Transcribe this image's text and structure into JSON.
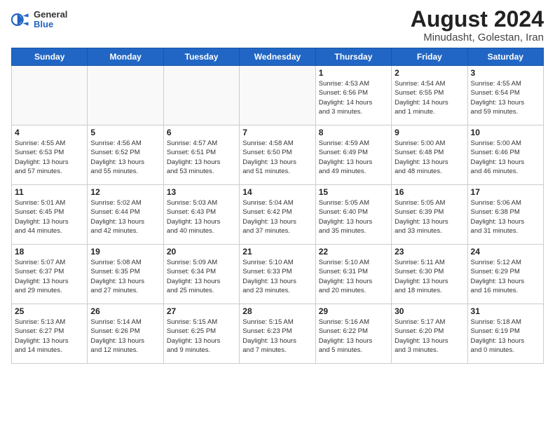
{
  "header": {
    "logo_general": "General",
    "logo_blue": "Blue",
    "title": "August 2024",
    "subtitle": "Minudasht, Golestan, Iran"
  },
  "days_of_week": [
    "Sunday",
    "Monday",
    "Tuesday",
    "Wednesday",
    "Thursday",
    "Friday",
    "Saturday"
  ],
  "weeks": [
    [
      {
        "day": "",
        "info": ""
      },
      {
        "day": "",
        "info": ""
      },
      {
        "day": "",
        "info": ""
      },
      {
        "day": "",
        "info": ""
      },
      {
        "day": "1",
        "info": "Sunrise: 4:53 AM\nSunset: 6:56 PM\nDaylight: 14 hours\nand 3 minutes."
      },
      {
        "day": "2",
        "info": "Sunrise: 4:54 AM\nSunset: 6:55 PM\nDaylight: 14 hours\nand 1 minute."
      },
      {
        "day": "3",
        "info": "Sunrise: 4:55 AM\nSunset: 6:54 PM\nDaylight: 13 hours\nand 59 minutes."
      }
    ],
    [
      {
        "day": "4",
        "info": "Sunrise: 4:55 AM\nSunset: 6:53 PM\nDaylight: 13 hours\nand 57 minutes."
      },
      {
        "day": "5",
        "info": "Sunrise: 4:56 AM\nSunset: 6:52 PM\nDaylight: 13 hours\nand 55 minutes."
      },
      {
        "day": "6",
        "info": "Sunrise: 4:57 AM\nSunset: 6:51 PM\nDaylight: 13 hours\nand 53 minutes."
      },
      {
        "day": "7",
        "info": "Sunrise: 4:58 AM\nSunset: 6:50 PM\nDaylight: 13 hours\nand 51 minutes."
      },
      {
        "day": "8",
        "info": "Sunrise: 4:59 AM\nSunset: 6:49 PM\nDaylight: 13 hours\nand 49 minutes."
      },
      {
        "day": "9",
        "info": "Sunrise: 5:00 AM\nSunset: 6:48 PM\nDaylight: 13 hours\nand 48 minutes."
      },
      {
        "day": "10",
        "info": "Sunrise: 5:00 AM\nSunset: 6:46 PM\nDaylight: 13 hours\nand 46 minutes."
      }
    ],
    [
      {
        "day": "11",
        "info": "Sunrise: 5:01 AM\nSunset: 6:45 PM\nDaylight: 13 hours\nand 44 minutes."
      },
      {
        "day": "12",
        "info": "Sunrise: 5:02 AM\nSunset: 6:44 PM\nDaylight: 13 hours\nand 42 minutes."
      },
      {
        "day": "13",
        "info": "Sunrise: 5:03 AM\nSunset: 6:43 PM\nDaylight: 13 hours\nand 40 minutes."
      },
      {
        "day": "14",
        "info": "Sunrise: 5:04 AM\nSunset: 6:42 PM\nDaylight: 13 hours\nand 37 minutes."
      },
      {
        "day": "15",
        "info": "Sunrise: 5:05 AM\nSunset: 6:40 PM\nDaylight: 13 hours\nand 35 minutes."
      },
      {
        "day": "16",
        "info": "Sunrise: 5:05 AM\nSunset: 6:39 PM\nDaylight: 13 hours\nand 33 minutes."
      },
      {
        "day": "17",
        "info": "Sunrise: 5:06 AM\nSunset: 6:38 PM\nDaylight: 13 hours\nand 31 minutes."
      }
    ],
    [
      {
        "day": "18",
        "info": "Sunrise: 5:07 AM\nSunset: 6:37 PM\nDaylight: 13 hours\nand 29 minutes."
      },
      {
        "day": "19",
        "info": "Sunrise: 5:08 AM\nSunset: 6:35 PM\nDaylight: 13 hours\nand 27 minutes."
      },
      {
        "day": "20",
        "info": "Sunrise: 5:09 AM\nSunset: 6:34 PM\nDaylight: 13 hours\nand 25 minutes."
      },
      {
        "day": "21",
        "info": "Sunrise: 5:10 AM\nSunset: 6:33 PM\nDaylight: 13 hours\nand 23 minutes."
      },
      {
        "day": "22",
        "info": "Sunrise: 5:10 AM\nSunset: 6:31 PM\nDaylight: 13 hours\nand 20 minutes."
      },
      {
        "day": "23",
        "info": "Sunrise: 5:11 AM\nSunset: 6:30 PM\nDaylight: 13 hours\nand 18 minutes."
      },
      {
        "day": "24",
        "info": "Sunrise: 5:12 AM\nSunset: 6:29 PM\nDaylight: 13 hours\nand 16 minutes."
      }
    ],
    [
      {
        "day": "25",
        "info": "Sunrise: 5:13 AM\nSunset: 6:27 PM\nDaylight: 13 hours\nand 14 minutes."
      },
      {
        "day": "26",
        "info": "Sunrise: 5:14 AM\nSunset: 6:26 PM\nDaylight: 13 hours\nand 12 minutes."
      },
      {
        "day": "27",
        "info": "Sunrise: 5:15 AM\nSunset: 6:25 PM\nDaylight: 13 hours\nand 9 minutes."
      },
      {
        "day": "28",
        "info": "Sunrise: 5:15 AM\nSunset: 6:23 PM\nDaylight: 13 hours\nand 7 minutes."
      },
      {
        "day": "29",
        "info": "Sunrise: 5:16 AM\nSunset: 6:22 PM\nDaylight: 13 hours\nand 5 minutes."
      },
      {
        "day": "30",
        "info": "Sunrise: 5:17 AM\nSunset: 6:20 PM\nDaylight: 13 hours\nand 3 minutes."
      },
      {
        "day": "31",
        "info": "Sunrise: 5:18 AM\nSunset: 6:19 PM\nDaylight: 13 hours\nand 0 minutes."
      }
    ]
  ]
}
